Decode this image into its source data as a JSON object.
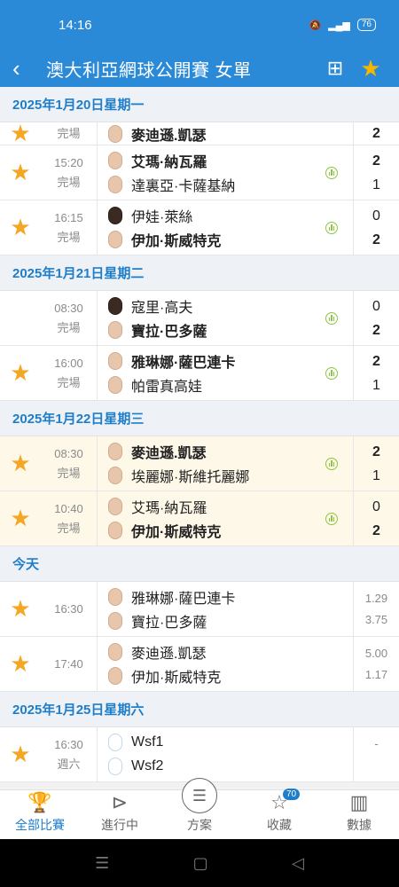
{
  "status_bar": {
    "time": "14:16",
    "battery": "76"
  },
  "header": {
    "title": "澳大利亞網球公開賽 女單"
  },
  "ghost_row": {
    "text": "雅琳娜·薩巴連卡",
    "score": "1"
  },
  "days": [
    {
      "date": "2025年1月20日星期一",
      "matches": [
        {
          "starred": true,
          "time": "",
          "status": "完場",
          "partial": true,
          "p1": {
            "name": "麥迪遜.凱瑟",
            "win": false
          },
          "p2": {
            "name": "麥迪遜.凱瑟",
            "win": true
          },
          "s1": "",
          "s2": "2",
          "stat": false,
          "hl": false
        },
        {
          "starred": true,
          "time": "15:20",
          "status": "完場",
          "p1": {
            "name": "艾瑪·納瓦羅",
            "win": true
          },
          "p2": {
            "name": "達裏亞·卡薩基納",
            "win": false
          },
          "s1": "2",
          "s2": "1",
          "stat": true,
          "hl": false
        },
        {
          "starred": true,
          "time": "16:15",
          "status": "完場",
          "p1": {
            "name": "伊娃·萊絲",
            "win": false
          },
          "p2": {
            "name": "伊加·斯威特克",
            "win": true
          },
          "s1": "0",
          "s2": "2",
          "stat": true,
          "hl": false
        }
      ]
    },
    {
      "date": "2025年1月21日星期二",
      "matches": [
        {
          "starred": false,
          "time": "08:30",
          "status": "完場",
          "p1": {
            "name": "寇里·高夫",
            "win": false
          },
          "p2": {
            "name": "寶拉·巴多薩",
            "win": true
          },
          "s1": "0",
          "s2": "2",
          "stat": true,
          "hl": false
        },
        {
          "starred": true,
          "time": "16:00",
          "status": "完場",
          "p1": {
            "name": "雅琳娜·薩巴連卡",
            "win": true
          },
          "p2": {
            "name": "帕雷真高娃",
            "win": false
          },
          "s1": "2",
          "s2": "1",
          "stat": true,
          "hl": false
        }
      ]
    },
    {
      "date": "2025年1月22日星期三",
      "matches": [
        {
          "starred": true,
          "time": "08:30",
          "status": "完場",
          "p1": {
            "name": "麥迪遜.凱瑟",
            "win": true
          },
          "p2": {
            "name": "埃麗娜·斯維托麗娜",
            "win": false
          },
          "s1": "2",
          "s2": "1",
          "stat": true,
          "hl": true
        },
        {
          "starred": true,
          "time": "10:40",
          "status": "完場",
          "p1": {
            "name": "艾瑪·納瓦羅",
            "win": false
          },
          "p2": {
            "name": "伊加·斯威特克",
            "win": true
          },
          "s1": "0",
          "s2": "2",
          "stat": true,
          "hl": true
        }
      ]
    },
    {
      "date": "今天",
      "matches": [
        {
          "starred": true,
          "time": "16:30",
          "status": "",
          "p1": {
            "name": "雅琳娜·薩巴連卡",
            "win": false
          },
          "p2": {
            "name": "寶拉·巴多薩",
            "win": false
          },
          "o1": "1.29",
          "o2": "3.75",
          "stat": false,
          "hl": false
        },
        {
          "starred": true,
          "time": "17:40",
          "status": "",
          "p1": {
            "name": "麥迪遜.凱瑟",
            "win": false
          },
          "p2": {
            "name": "伊加·斯威特克",
            "win": false
          },
          "o1": "5.00",
          "o2": "1.17",
          "stat": false,
          "hl": false
        }
      ]
    },
    {
      "date": "2025年1月25日星期六",
      "matches": [
        {
          "starred": true,
          "time": "16:30",
          "status": "週六",
          "blank": true,
          "p1": {
            "name": "Wsf1",
            "win": false
          },
          "p2": {
            "name": "Wsf2",
            "win": false
          },
          "o1": "-",
          "o2": "",
          "stat": false,
          "hl": false
        }
      ]
    }
  ],
  "bottom_nav": [
    {
      "label": "全部比賽",
      "icon": "trophy-icon",
      "active": true
    },
    {
      "label": "進行中",
      "icon": "play-icon",
      "active": false
    },
    {
      "label": "方案",
      "icon": "document-icon",
      "active": false
    },
    {
      "label": "收藏",
      "icon": "star-icon",
      "active": false,
      "badge": "70"
    },
    {
      "label": "數據",
      "icon": "chart-icon",
      "active": false
    }
  ],
  "colors": {
    "primary": "#2a8ad8",
    "accent_star": "#f5a623",
    "date_text": "#1f7ec9",
    "stat_green": "#8cc63f"
  }
}
